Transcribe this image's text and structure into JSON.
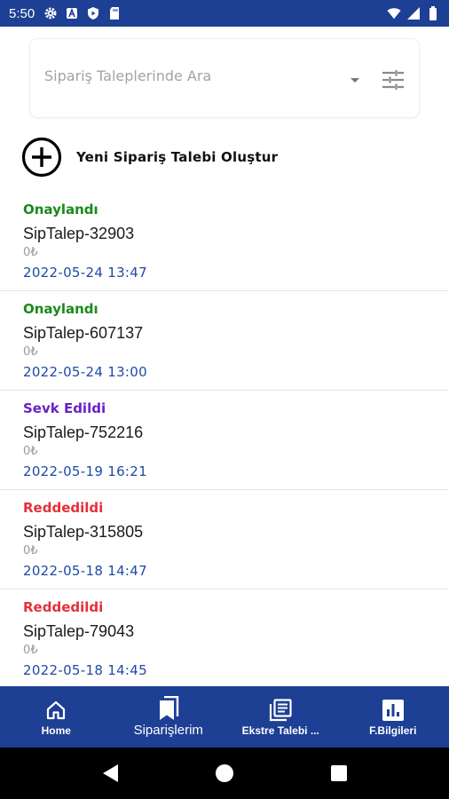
{
  "status_bar": {
    "time": "5:50"
  },
  "search": {
    "placeholder": "Sipariş Taleplerinde Ara",
    "value": ""
  },
  "new_request": {
    "label": "Yeni Sipariş Talebi Oluştur"
  },
  "orders": [
    {
      "status": "Onaylandı",
      "status_color": "#1a8a1a",
      "name": "SipTalep-32903",
      "amount": "0₺",
      "date": "2022-05-24 13:47"
    },
    {
      "status": "Onaylandı",
      "status_color": "#1a8a1a",
      "name": "SipTalep-607137",
      "amount": "0₺",
      "date": "2022-05-24 13:00"
    },
    {
      "status": "Sevk Edildi",
      "status_color": "#6a1fc8",
      "name": "SipTalep-752216",
      "amount": "0₺",
      "date": "2022-05-19 16:21"
    },
    {
      "status": "Reddedildi",
      "status_color": "#e5303a",
      "name": "SipTalep-315805",
      "amount": "0₺",
      "date": "2022-05-18 14:47"
    },
    {
      "status": "Reddedildi",
      "status_color": "#e5303a",
      "name": "SipTalep-79043",
      "amount": "0₺",
      "date": "2022-05-18 14:45"
    }
  ],
  "bottom_nav": {
    "items": [
      {
        "label": "Home",
        "icon": "home-icon"
      },
      {
        "label": "Siparişlerim",
        "icon": "bookmark-icon",
        "active": true
      },
      {
        "label": "Ekstre Talebi ...",
        "icon": "document-list-icon"
      },
      {
        "label": "F.Bilgileri",
        "icon": "bar-chart-icon"
      }
    ]
  },
  "colors": {
    "primary": "#1d3f94",
    "date": "#1f4aa8",
    "approved": "#1a8a1a",
    "shipped": "#6a1fc8",
    "rejected": "#e5303a"
  }
}
